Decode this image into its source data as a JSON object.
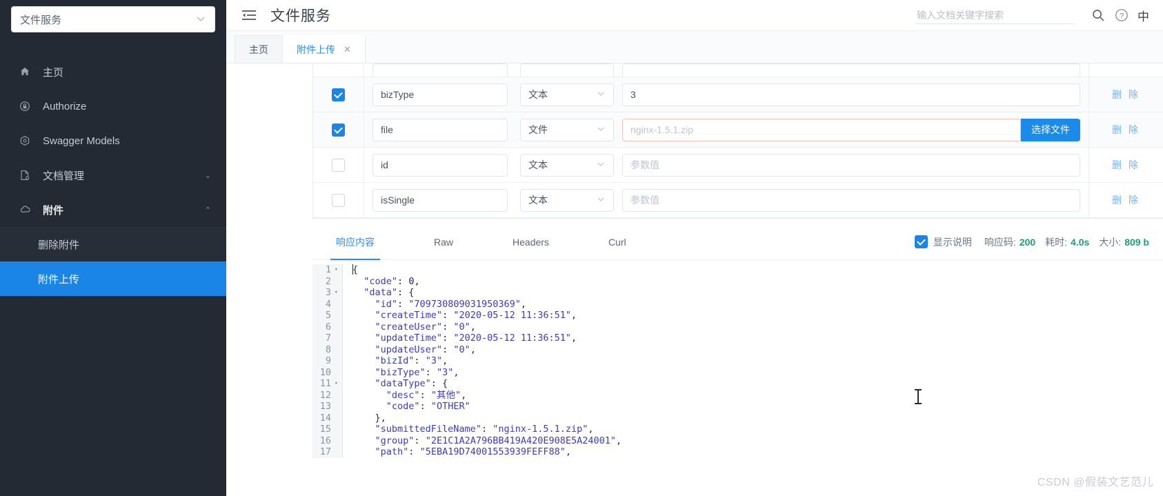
{
  "sidebar": {
    "service_select": {
      "value": "文件服务",
      "icon": "chevron-down-icon"
    },
    "items": [
      {
        "label": "主页",
        "icon": "home-icon",
        "arrow": "",
        "type": "item"
      },
      {
        "label": "Authorize",
        "icon": "lock-icon",
        "arrow": "",
        "type": "item"
      },
      {
        "label": "Swagger Models",
        "icon": "cube-icon",
        "arrow": "",
        "type": "item"
      },
      {
        "label": "文档管理",
        "icon": "document-gear-icon",
        "arrow": "⌄",
        "type": "item"
      },
      {
        "label": "附件",
        "icon": "cloud-icon",
        "arrow": "⌃",
        "type": "item-bold"
      }
    ],
    "sub_items": [
      {
        "label": "删除附件",
        "active": false
      },
      {
        "label": "附件上传",
        "active": true
      }
    ]
  },
  "topbar": {
    "menu_icon": "hamburger-collapse-icon",
    "title": "文件服务",
    "search": {
      "value": "",
      "placeholder": "输入文档关键字搜索"
    },
    "search_icon": "search-icon",
    "help_icon": "question-circle-icon",
    "lang_label": "中"
  },
  "page_tabs": [
    {
      "label": "主页",
      "active": false,
      "closable": false
    },
    {
      "label": "附件上传",
      "active": true,
      "closable": true,
      "close_icon": "close-icon"
    }
  ],
  "params": {
    "type_placeholder": "参数值",
    "rows": [
      {
        "checked": true,
        "name": "bizType",
        "type": "文本",
        "value": "3",
        "value_is_placeholder": false,
        "kind": "text",
        "action": "删 除"
      },
      {
        "checked": true,
        "name": "file",
        "type": "文件",
        "value": "nginx-1.5.1.zip",
        "value_is_placeholder": true,
        "kind": "file",
        "file_button": "选择文件",
        "action": "删 除"
      },
      {
        "checked": false,
        "name": "id",
        "type": "文本",
        "value": "参数值",
        "value_is_placeholder": true,
        "kind": "text",
        "action": "删 除"
      },
      {
        "checked": false,
        "name": "isSingle",
        "type": "文本",
        "value": "参数值",
        "value_is_placeholder": true,
        "kind": "text",
        "action": "删 除"
      }
    ]
  },
  "response": {
    "tabs": [
      {
        "label": "响应内容",
        "active": true
      },
      {
        "label": "Raw",
        "active": false
      },
      {
        "label": "Headers",
        "active": false
      },
      {
        "label": "Curl",
        "active": false
      }
    ],
    "show_desc": {
      "label": "显示说明",
      "checked": true
    },
    "status": [
      {
        "key": "响应码:",
        "value": "200"
      },
      {
        "key": "耗时:",
        "value": "4.0s"
      },
      {
        "key": "大小:",
        "value": "809 b"
      }
    ],
    "code_lines": [
      {
        "n": 1,
        "fold": true,
        "text": "{"
      },
      {
        "n": 2,
        "fold": false,
        "text": "  \"code\": 0,"
      },
      {
        "n": 3,
        "fold": true,
        "text": "  \"data\": {"
      },
      {
        "n": 4,
        "fold": false,
        "text": "    \"id\": \"709730809031950369\","
      },
      {
        "n": 5,
        "fold": false,
        "text": "    \"createTime\": \"2020-05-12 11:36:51\","
      },
      {
        "n": 6,
        "fold": false,
        "text": "    \"createUser\": \"0\","
      },
      {
        "n": 7,
        "fold": false,
        "text": "    \"updateTime\": \"2020-05-12 11:36:51\","
      },
      {
        "n": 8,
        "fold": false,
        "text": "    \"updateUser\": \"0\","
      },
      {
        "n": 9,
        "fold": false,
        "text": "    \"bizId\": \"3\","
      },
      {
        "n": 10,
        "fold": false,
        "text": "    \"bizType\": \"3\","
      },
      {
        "n": 11,
        "fold": true,
        "text": "    \"dataType\": {"
      },
      {
        "n": 12,
        "fold": false,
        "text": "      \"desc\": \"其他\","
      },
      {
        "n": 13,
        "fold": false,
        "text": "      \"code\": \"OTHER\""
      },
      {
        "n": 14,
        "fold": false,
        "text": "    },"
      },
      {
        "n": 15,
        "fold": false,
        "text": "    \"submittedFileName\": \"nginx-1.5.1.zip\","
      },
      {
        "n": 16,
        "fold": false,
        "text": "    \"group\": \"2E1C1A2A796BB419A420E908E5A24001\","
      },
      {
        "n": 17,
        "fold": false,
        "text": "    \"path\": \"5EBA19D74001553939FEFF88\","
      }
    ]
  },
  "watermark": "CSDN @假装文艺范儿",
  "colors": {
    "accent": "#1b84e7",
    "sidebar_bg": "#232a33",
    "active_sub": "#1b84e7",
    "status_value": "#1aa179",
    "delete_link": "#74b3ef"
  }
}
